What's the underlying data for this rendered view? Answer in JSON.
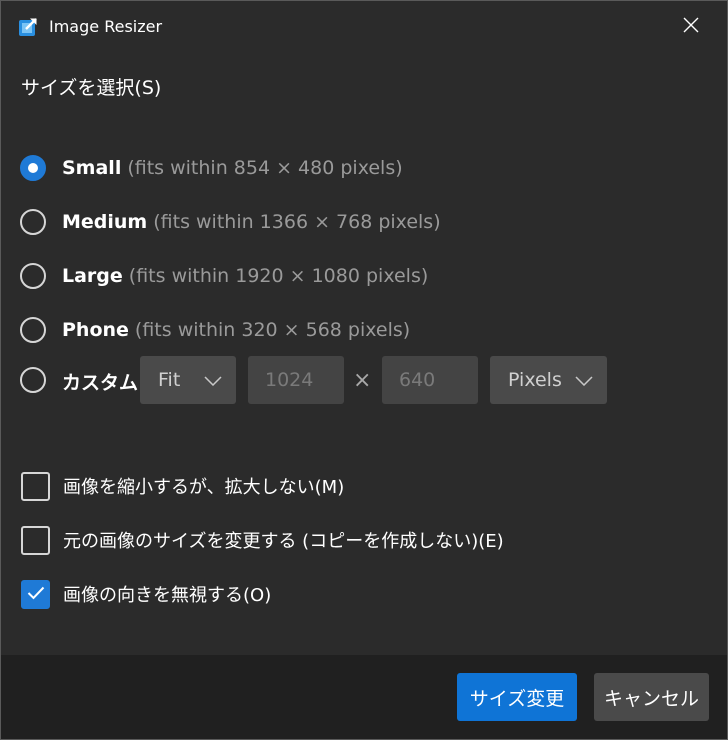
{
  "window": {
    "title": "Image Resizer",
    "accent_color": "#1f7ad6"
  },
  "size_section": {
    "heading": "サイズを選択(S)",
    "options": [
      {
        "name": "Small",
        "description": "(fits within 854 × 480 pixels)",
        "selected": true
      },
      {
        "name": "Medium",
        "description": "(fits within 1366 × 768 pixels)",
        "selected": false
      },
      {
        "name": "Large",
        "description": "(fits within 1920 × 1080 pixels)",
        "selected": false
      },
      {
        "name": "Phone",
        "description": "(fits within 320 × 568 pixels)",
        "selected": false
      }
    ],
    "custom": {
      "label": "カスタム",
      "selected": false,
      "fit_mode": "Fit",
      "width": "1024",
      "times_symbol": "×",
      "height": "640",
      "unit": "Pixels"
    }
  },
  "checkboxes": [
    {
      "label": "画像を縮小するが、拡大しない(M)",
      "checked": false
    },
    {
      "label": "元の画像のサイズを変更する (コピーを作成しない)(E)",
      "checked": false
    },
    {
      "label": "画像の向きを無視する(O)",
      "checked": true
    }
  ],
  "footer": {
    "resize_label": "サイズ変更",
    "cancel_label": "キャンセル"
  }
}
